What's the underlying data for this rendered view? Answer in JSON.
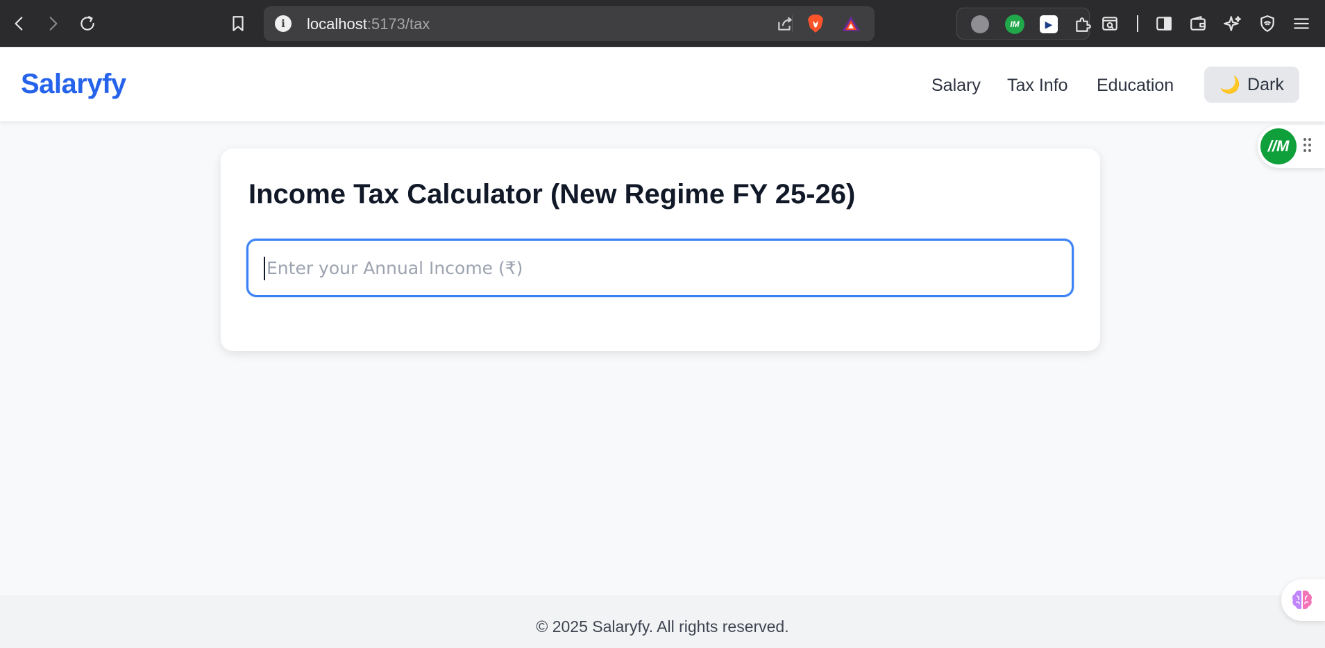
{
  "browser": {
    "url_host": "localhost",
    "url_path": ":5173/tax"
  },
  "app": {
    "logo": "Salaryfy",
    "nav": {
      "salary": "Salary",
      "tax_info": "Tax Info",
      "education": "Education"
    },
    "theme_toggle": {
      "icon": "🌙",
      "label": "Dark"
    }
  },
  "calculator": {
    "title": "Income Tax Calculator (New Regime FY 25-26)",
    "income_input": {
      "value": "",
      "placeholder": "Enter your Annual Income (₹)"
    }
  },
  "floating_widget": {
    "badge": "//M"
  },
  "footer": {
    "text": "© 2025 Salaryfy. All rights reserved."
  },
  "colors": {
    "brand": "#2563eb",
    "input_focus": "#3b82f6",
    "page_bg": "#f8f9fb"
  }
}
